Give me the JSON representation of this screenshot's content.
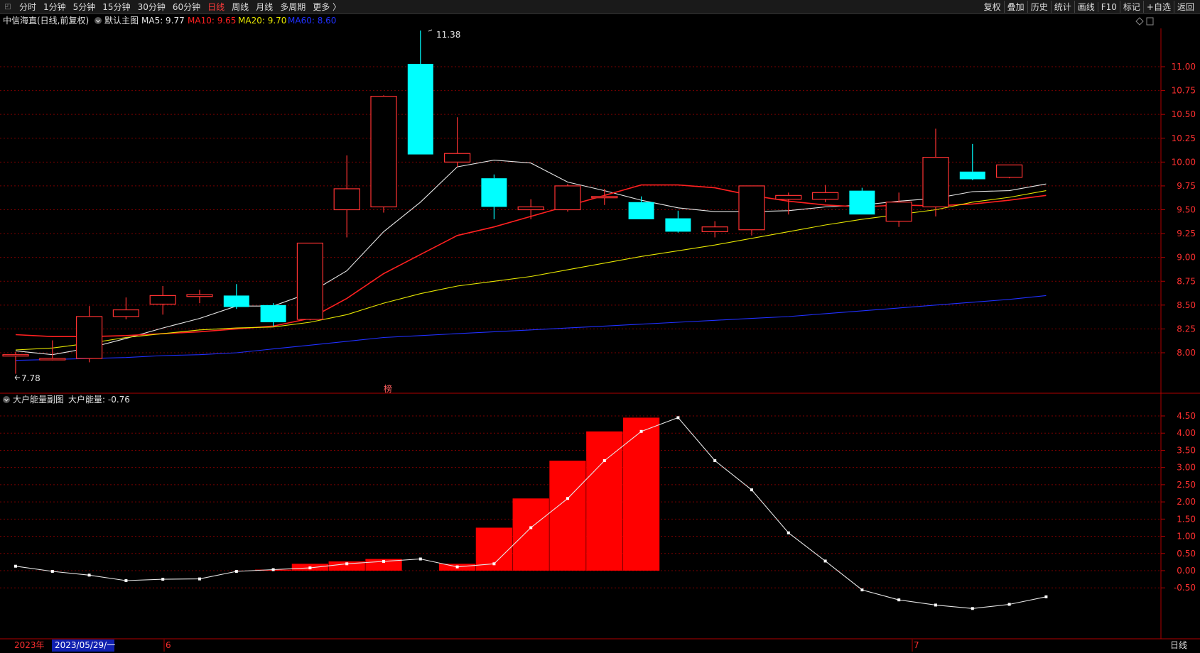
{
  "topbar": {
    "tabs": [
      {
        "label": "分时",
        "active": false
      },
      {
        "label": "1分钟",
        "active": false
      },
      {
        "label": "5分钟",
        "active": false
      },
      {
        "label": "15分钟",
        "active": false
      },
      {
        "label": "30分钟",
        "active": false
      },
      {
        "label": "60分钟",
        "active": false
      },
      {
        "label": "日线",
        "active": true
      },
      {
        "label": "周线",
        "active": false
      },
      {
        "label": "月线",
        "active": false
      },
      {
        "label": "多周期",
        "active": false
      },
      {
        "label": "更多 〉",
        "active": false
      }
    ],
    "tools": [
      "复权",
      "叠加",
      "历史",
      "统计",
      "画线",
      "F10",
      "标记",
      "+自选",
      "返回"
    ]
  },
  "main_header": {
    "title": "中信海直(日线,前复权)",
    "indicator": "默认主图",
    "ma5": "MA5: 9.77",
    "ma10": "MA10: 9.65",
    "ma20": "MA20: 9.70",
    "ma60": "MA60: 8.60"
  },
  "sub_header": {
    "title": "大户能量副图",
    "value": "大户能量: -0.76"
  },
  "markers": {
    "high": "11.38",
    "low": "7.78",
    "bang": "榜"
  },
  "date_bar": {
    "year": "2023年",
    "cursor": "2023/05/29/一",
    "m6": "6",
    "m7": "7"
  },
  "period_label": "日线",
  "colors": {
    "up": "#ff3232",
    "down": "#00ffff",
    "ma5": "#e6e6e6",
    "ma10": "#ff2020",
    "ma20": "#e6e600",
    "ma60": "#2030ff",
    "grid": "#7a0000",
    "axis": "#b00000"
  },
  "chart_data": [
    {
      "type": "candlestick",
      "title": "中信海直(日线,前复权)",
      "ylim": [
        7.7,
        11.5
      ],
      "yticks": [
        8.0,
        8.25,
        8.5,
        8.75,
        9.0,
        9.25,
        9.5,
        9.75,
        10.0,
        10.25,
        10.5,
        10.75,
        11.0
      ],
      "candles": [
        {
          "o": 7.98,
          "h": 8.01,
          "l": 7.78,
          "c": 7.98
        },
        {
          "o": 7.94,
          "h": 8.13,
          "l": 7.92,
          "c": 7.94
        },
        {
          "o": 7.94,
          "h": 8.49,
          "l": 7.9,
          "c": 8.38
        },
        {
          "o": 8.38,
          "h": 8.58,
          "l": 8.35,
          "c": 8.45
        },
        {
          "o": 8.51,
          "h": 8.7,
          "l": 8.4,
          "c": 8.6
        },
        {
          "o": 8.59,
          "h": 8.66,
          "l": 8.52,
          "c": 8.61
        },
        {
          "o": 8.6,
          "h": 8.72,
          "l": 8.46,
          "c": 8.48
        },
        {
          "o": 8.5,
          "h": 8.52,
          "l": 8.28,
          "c": 8.32
        },
        {
          "o": 8.35,
          "h": 9.15,
          "l": 8.34,
          "c": 9.15
        },
        {
          "o": 9.5,
          "h": 10.07,
          "l": 9.21,
          "c": 9.72
        },
        {
          "o": 9.53,
          "h": 10.7,
          "l": 9.47,
          "c": 10.69
        },
        {
          "o": 11.03,
          "h": 11.38,
          "l": 10.08,
          "c": 10.08
        },
        {
          "o": 10.0,
          "h": 10.47,
          "l": 9.95,
          "c": 10.09
        },
        {
          "o": 9.83,
          "h": 9.87,
          "l": 9.4,
          "c": 9.53
        },
        {
          "o": 9.5,
          "h": 9.61,
          "l": 9.4,
          "c": 9.53
        },
        {
          "o": 9.5,
          "h": 9.77,
          "l": 9.48,
          "c": 9.75
        },
        {
          "o": 9.64,
          "h": 9.72,
          "l": 9.55,
          "c": 9.64
        },
        {
          "o": 9.58,
          "h": 9.64,
          "l": 9.4,
          "c": 9.4
        },
        {
          "o": 9.41,
          "h": 9.49,
          "l": 9.26,
          "c": 9.27
        },
        {
          "o": 9.27,
          "h": 9.38,
          "l": 9.21,
          "c": 9.32
        },
        {
          "o": 9.29,
          "h": 9.75,
          "l": 9.23,
          "c": 9.75
        },
        {
          "o": 9.61,
          "h": 9.68,
          "l": 9.45,
          "c": 9.65
        },
        {
          "o": 9.61,
          "h": 9.76,
          "l": 9.58,
          "c": 9.68
        },
        {
          "o": 9.7,
          "h": 9.73,
          "l": 9.45,
          "c": 9.45
        },
        {
          "o": 9.38,
          "h": 9.68,
          "l": 9.32,
          "c": 9.58
        },
        {
          "o": 9.53,
          "h": 10.35,
          "l": 9.43,
          "c": 10.05
        },
        {
          "o": 9.9,
          "h": 10.19,
          "l": 9.81,
          "c": 9.82
        },
        {
          "o": 9.84,
          "h": 9.97,
          "l": 9.83,
          "c": 9.97
        }
      ],
      "ma": [
        {
          "name": "MA5",
          "values": [
            8.02,
            7.98,
            8.05,
            8.15,
            8.26,
            8.36,
            8.49,
            8.49,
            8.63,
            8.86,
            9.27,
            9.58,
            9.95,
            10.02,
            9.99,
            9.79,
            9.7,
            9.6,
            9.52,
            9.48,
            9.48,
            9.49,
            9.53,
            9.55,
            9.59,
            9.62,
            9.69,
            9.7,
            9.77
          ]
        },
        {
          "name": "MA10",
          "values": [
            8.19,
            8.17,
            8.17,
            8.18,
            8.2,
            8.22,
            8.25,
            8.28,
            8.36,
            8.57,
            8.83,
            9.03,
            9.23,
            9.32,
            9.43,
            9.54,
            9.65,
            9.76,
            9.76,
            9.73,
            9.65,
            9.59,
            9.55,
            9.53,
            9.55,
            9.54,
            9.56,
            9.6,
            9.65
          ]
        },
        {
          "name": "MA20",
          "values": [
            8.03,
            8.05,
            8.1,
            8.16,
            8.2,
            8.24,
            8.26,
            8.27,
            8.32,
            8.4,
            8.52,
            8.62,
            8.7,
            8.75,
            8.8,
            8.87,
            8.94,
            9.01,
            9.07,
            9.13,
            9.2,
            9.27,
            9.34,
            9.4,
            9.45,
            9.5,
            9.58,
            9.63,
            9.7
          ]
        },
        {
          "name": "MA60",
          "values": [
            7.92,
            7.93,
            7.94,
            7.95,
            7.97,
            7.98,
            8.0,
            8.04,
            8.08,
            8.12,
            8.16,
            8.18,
            8.2,
            8.22,
            8.24,
            8.26,
            8.28,
            8.3,
            8.32,
            8.34,
            8.36,
            8.38,
            8.41,
            8.44,
            8.47,
            8.5,
            8.53,
            8.56,
            8.6
          ]
        }
      ]
    },
    {
      "type": "bar",
      "title": "大户能量副图",
      "ylim": [
        -1.2,
        4.7
      ],
      "yticks": [
        -0.5,
        0.0,
        0.5,
        1.0,
        1.5,
        2.0,
        2.5,
        3.0,
        3.5,
        4.0,
        4.5
      ],
      "line": [
        0.13,
        -0.02,
        -0.13,
        -0.29,
        -0.25,
        -0.24,
        -0.02,
        0.03,
        0.08,
        0.2,
        0.27,
        0.34,
        0.11,
        0.2,
        1.25,
        2.1,
        3.2,
        4.05,
        4.45,
        3.2,
        2.35,
        1.1,
        0.28,
        -0.56,
        -0.85,
        -1.0,
        -1.1,
        -0.98,
        -0.76
      ],
      "bars": [
        0,
        0,
        0,
        0,
        0,
        0,
        0,
        0.03,
        0.2,
        0.27,
        0.34,
        0,
        0.2,
        1.25,
        2.1,
        3.2,
        4.05,
        4.45,
        0,
        0,
        0,
        0,
        0,
        0,
        0,
        0,
        0,
        0,
        0
      ]
    }
  ]
}
